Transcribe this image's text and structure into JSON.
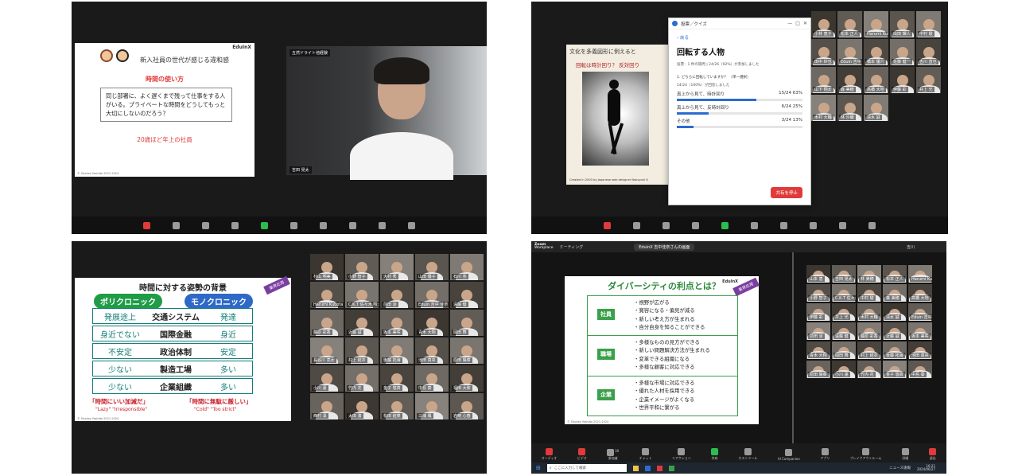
{
  "panel1": {
    "slide": {
      "brand": "EduInX",
      "title": "新入社員の世代が感じる違和感",
      "subtitle": "時間の使い方",
      "body": "同じ部署に、よく遅くまで残って仕事をする人がいる。プライベートな時間をどうしてもっと大切にしないのだろう？",
      "footer_note": "20歳ほど年上の社員",
      "copyright": "© Shudeo Yoshida 2021-2024"
    },
    "speaker_badge": "五然ドライト他経験",
    "speaker_name": "吉田 晃太"
  },
  "panel2": {
    "slide_header": "文化を多義図形に例えると",
    "slide_question": "回転は時計回り？ 反対回り",
    "slide_caption": "Created in 2003 by Japanese web designer Nobuyuki K",
    "poll_window_title": "投票／クイズ",
    "poll_back": "戻る",
    "poll_title": "回転する人物",
    "poll_meta": "投票：1 件の質問 | 24/26（92%）が参加しました",
    "poll_question": "1. どちらに回転していますか？ （単一選択）",
    "poll_answered": "24/24（100%）が回答しました",
    "options": [
      {
        "label": "真上から見て、時計回り",
        "stat": "15/24 63%",
        "pct": 63
      },
      {
        "label": "真上から見て、反時計回り",
        "stat": "6/24 25%",
        "pct": 25
      },
      {
        "label": "その他",
        "stat": "3/24 13%",
        "pct": 13
      }
    ],
    "end_button": "共有を停止",
    "participants": [
      "小林 恵子",
      "松本 正人",
      "Harumi Kubota",
      "出田 輝人",
      "中村 駿",
      "田中 紗也",
      "Eduin 吉中 佳奈",
      "橋本 優介",
      "佐藤 健一",
      "吉川 直也",
      "山下 翔太",
      "森 美穂",
      "高橋 大地",
      "伊藤 彩",
      "井上 光",
      "木村 大輔",
      "林 沙織",
      "清水 誠"
    ]
  },
  "panel3": {
    "slide": {
      "title": "時間に対する姿勢の背景",
      "tag": "業界応用",
      "poly": "ポリクロニック",
      "mono": "モノクロニック",
      "rows": [
        {
          "left": "発展途上",
          "mid": "交通システム",
          "right": "発達"
        },
        {
          "left": "身近でない",
          "mid": "国際金融",
          "right": "身近"
        },
        {
          "left": "不安定",
          "mid": "政治体制",
          "right": "安定"
        },
        {
          "left": "少ない",
          "mid": "製造工場",
          "right": "多い"
        },
        {
          "left": "少ない",
          "mid": "企業組織",
          "right": "多い"
        }
      ],
      "quote_left": "「時間にいい加減だ」",
      "quote_left_en": "\"Lazy\" \"Irresponsible\"",
      "quote_right": "「時間に無駄に厳しい」",
      "quote_right_en": "\"Cold\" \"Too strict\"",
      "copyright": "© Shudeo Yoshida 2021-2024"
    },
    "participants": [
      "杉山 明美",
      "小野 智子",
      "大村 秀",
      "山田 優子",
      "石川 亮",
      "Harumi Kubota",
      "C.K.T 佐々木 翔太",
      "前田 涼",
      "Eduin 吉中 佳奈",
      "遠藤 健",
      "藤原 彩香",
      "近藤 誠",
      "坂本 美咲",
      "青木 大翔",
      "岡田 舞",
      "長谷川 亮太",
      "村上 結衣",
      "後藤 拓海",
      "池田 真央",
      "原田 陽菜",
      "小川 蓮",
      "竹内 花",
      "金子 悠真",
      "中島 葵",
      "福田 大和",
      "西村 凛",
      "太田 湊",
      "松田 結菜",
      "三浦 颯",
      "岩崎 心春"
    ]
  },
  "panel4": {
    "app_name": "Zoom",
    "app_sub": "Workplace",
    "meeting_label": "ミーティング",
    "share_tab": "EduinX 吉中佳奈さんの画面",
    "user_label": "吉川",
    "slide": {
      "title": "ダイバーシティの利点とは？",
      "brand": "EduInX",
      "tag": "業界応用",
      "groups": [
        {
          "label": "社員",
          "items": [
            "・視野が広がる",
            "・寛容になる・偏見が減る",
            "・新しい考え方が生まれる",
            "・自分自身を知ることができる"
          ]
        },
        {
          "label": "職場",
          "items": [
            "・多様なものの見方ができる",
            "・新しい問題解決方法が生まれる",
            "・変革できる組織になる",
            "・多様な顧客に対応できる"
          ]
        },
        {
          "label": "企業",
          "items": [
            "・多様な市場に対応できる",
            "・優れた人材を採用できる",
            "・企業イメージがよくなる",
            "・世界平和に繋がる"
          ]
        }
      ],
      "copyright": "© Shudeo Yoshida 2021-2024"
    },
    "toolbar": [
      "オーディオ",
      "ビデオ",
      "参加者",
      "チャット",
      "リアクション",
      "共有",
      "ホストツール",
      "AI Companion",
      "アプリ",
      "ブレイクアウトルーム",
      "詳細",
      "退出"
    ],
    "participant_count": "30",
    "taskbar_search": "ここに入力して検索",
    "taskbar_news": "ニュース速報",
    "clock_time": "16:21",
    "clock_date": "2024/06/27",
    "participants": [
      "山本 恵",
      "吉田 晃太",
      "林 美穂",
      "松本 正人",
      "Harumi Kubota",
      "小野 智子",
      "C.K.T 佐々木 翔太",
      "中村 駿",
      "森 美穂",
      "高橋 大地",
      "伊藤 彩",
      "井上 光",
      "木村 大輔",
      "清水 誠",
      "Eduin 吉中 佳奈",
      "前田 涼",
      "遠藤 健",
      "藤原 彩香",
      "近藤 誠",
      "坂本 美咲",
      "青木 大翔",
      "岡田 舞",
      "村上 結衣",
      "後藤 拓海",
      "池田 真央",
      "原田 陽菜",
      "小川 蓮",
      "竹内 花",
      "金子 悠真",
      "中島 葵"
    ]
  },
  "colors": {
    "accent_red": "#e03a3a",
    "poly_green": "#1f9c46",
    "mono_blue": "#2f69c8",
    "teal_text": "#157f7a",
    "diversity_green": "#3aa04a",
    "poll_blue": "#2d6bcf"
  }
}
